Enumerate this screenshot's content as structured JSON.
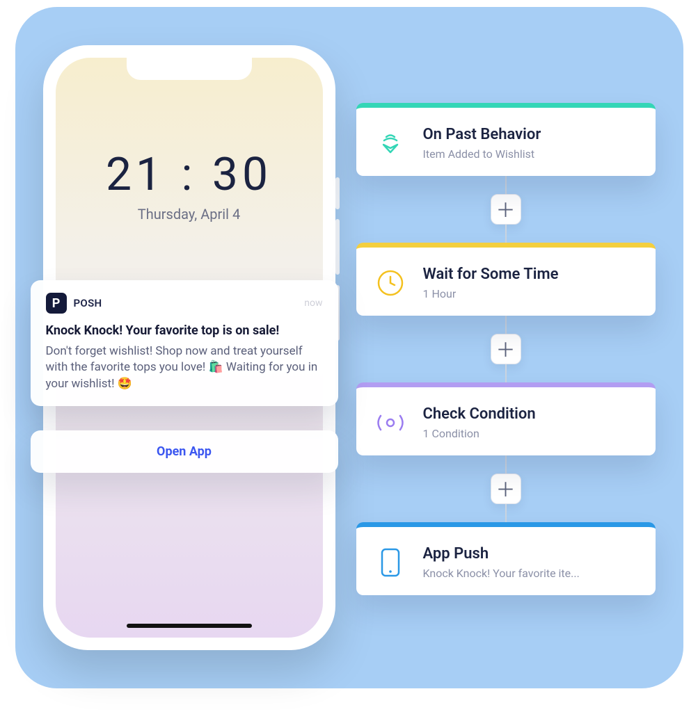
{
  "phone": {
    "time": "21 : 30",
    "date": "Thursday, April 4",
    "notification": {
      "app_badge_letter": "P",
      "app_name": "POSH",
      "timestamp": "now",
      "title": "Knock Knock! Your favorite top is on sale!",
      "body": "Don't forget wishlist! Shop now and treat yourself with the favorite tops you love! 🛍️ Waiting for you in your wishlist! 🤩"
    },
    "action_label": "Open App"
  },
  "flow": {
    "steps": [
      {
        "title": "On Past Behavior",
        "subtitle": "Item Added to Wishlist"
      },
      {
        "title": "Wait for Some Time",
        "subtitle": "1 Hour"
      },
      {
        "title": "Check Condition",
        "subtitle": "1 Condition"
      },
      {
        "title": "App Push",
        "subtitle": "Knock Knock! Your favorite ite..."
      }
    ],
    "add_label": "＋"
  }
}
